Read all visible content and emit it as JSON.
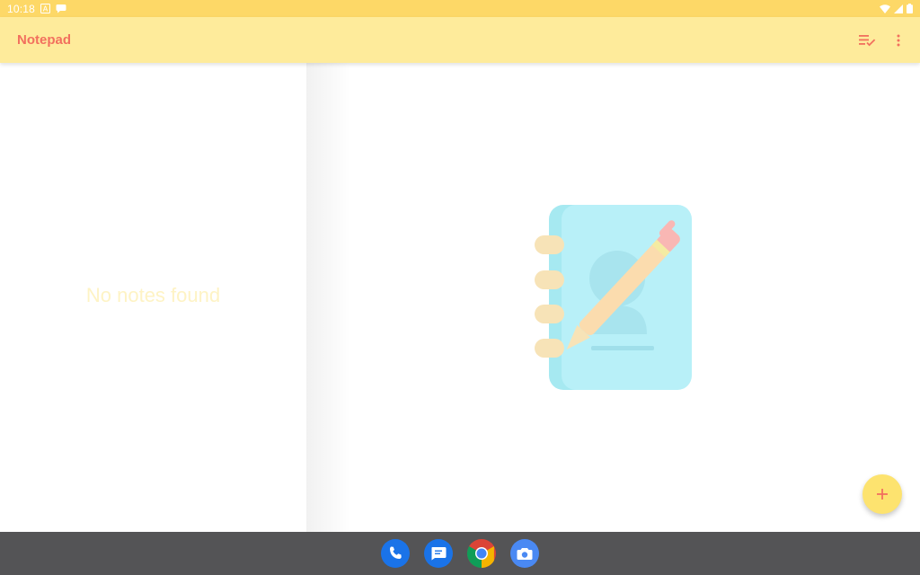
{
  "status_bar": {
    "time": "10:18",
    "icons": [
      "a-notification-icon",
      "chat-notification-icon",
      "wifi-icon",
      "signal-icon",
      "battery-icon"
    ]
  },
  "app_bar": {
    "title": "Notepad",
    "actions": [
      "sort-icon",
      "more-options-icon"
    ]
  },
  "list": {
    "empty_message": "No notes found"
  },
  "detail": {
    "illustration": "notebook-pen-illustration"
  },
  "fab": {
    "icon": "plus-icon",
    "label": "+"
  },
  "dock": {
    "apps": [
      "phone-app-icon",
      "messages-app-icon",
      "chrome-app-icon",
      "camera-app-icon"
    ]
  },
  "colors": {
    "status_bar": "#fdd867",
    "app_bar": "#feeb9b",
    "accent": "#f2705e",
    "fab": "#fde36f",
    "empty_text": "#fef3c4",
    "nav_bar": "#545456"
  }
}
